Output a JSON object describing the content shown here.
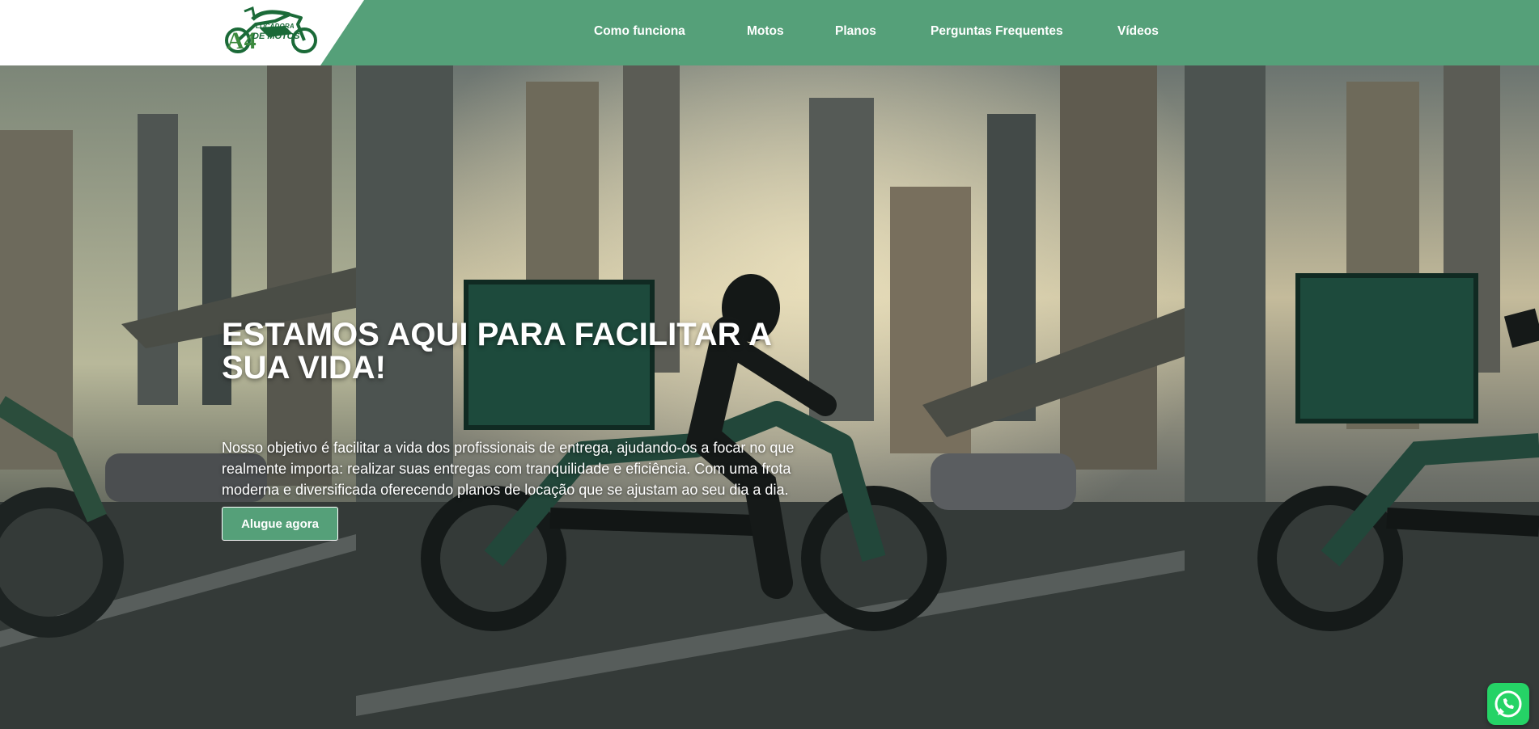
{
  "brand": {
    "logo_mark": "A4",
    "logo_line1": "LOCADORA",
    "logo_line2": "DE MOTOS",
    "color_primary": "#55a079",
    "color_logo": "#1b6a38"
  },
  "nav": {
    "items": [
      {
        "label": "Como funciona"
      },
      {
        "label": "Motos"
      },
      {
        "label": "Planos"
      },
      {
        "label": "Perguntas Frequentes"
      },
      {
        "label": "Vídeos"
      }
    ]
  },
  "hero": {
    "title": "ESTAMOS AQUI PARA FACILITAR A SUA VIDA!",
    "description": "Nosso objetivo é facilitar a vida dos profissionais de entrega, ajudando-os a focar no que realmente importa: realizar suas entregas com tranquilidade e eficiência. Com uma frota moderna e diversificada oferecendo planos de locação que se ajustam ao seu dia a dia.",
    "cta_label": "Alugue agora"
  },
  "floating": {
    "whatsapp_icon": "whatsapp-icon"
  }
}
